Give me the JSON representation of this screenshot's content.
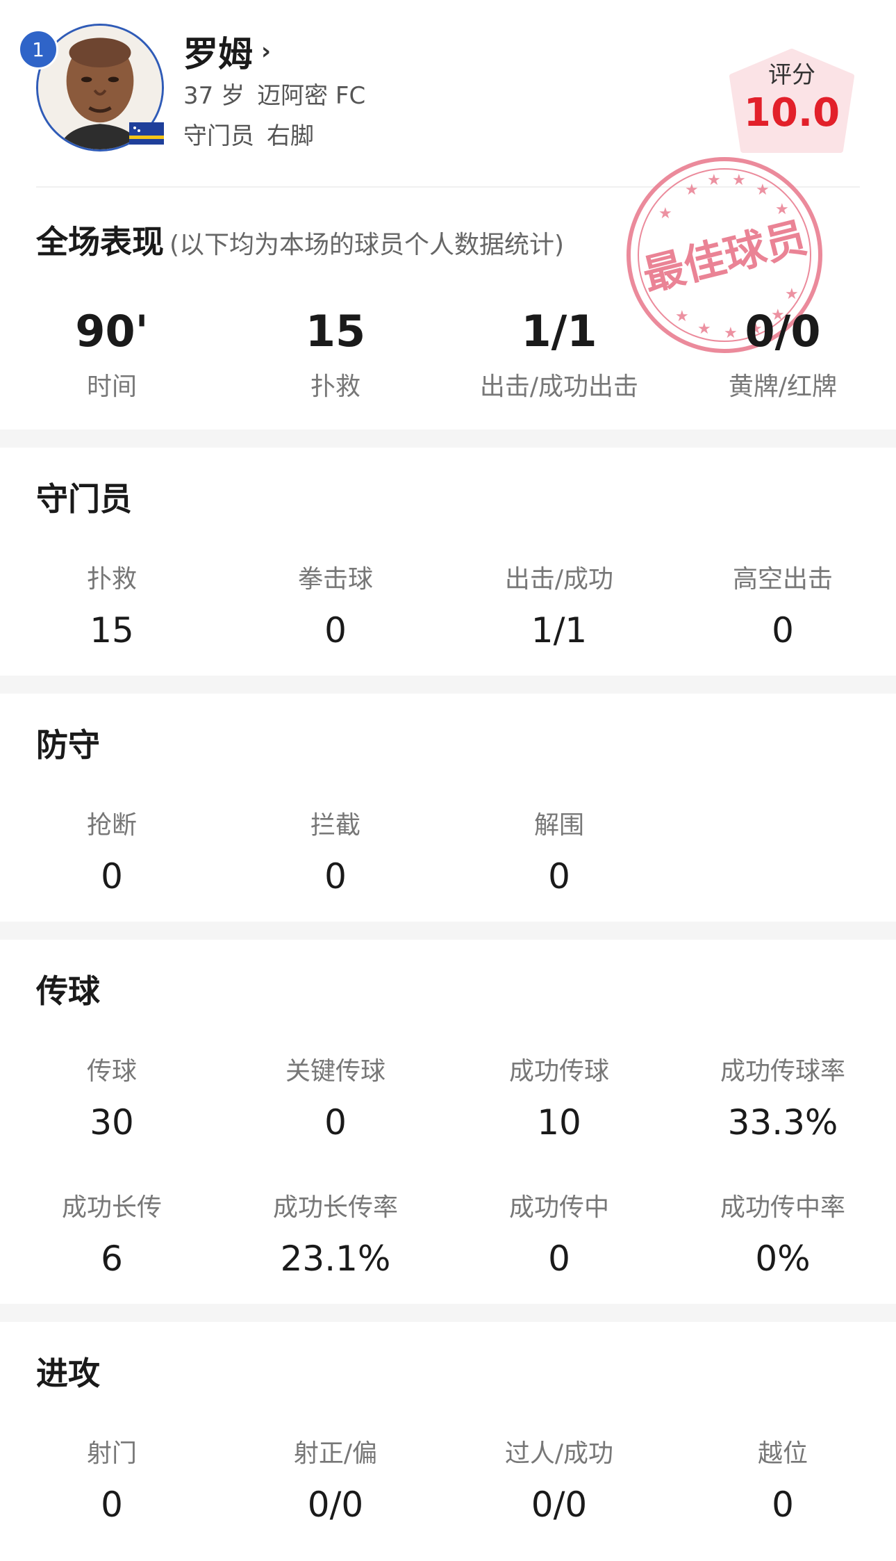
{
  "player": {
    "number": "1",
    "name": "罗姆",
    "age": "37 岁",
    "club": "迈阿密 FC",
    "position": "守门员",
    "foot": "右脚"
  },
  "rating": {
    "label": "评分",
    "value": "10.0",
    "color": "#e2202a",
    "badge_color": "#fbe3e6"
  },
  "stamp": {
    "text": "最佳球员",
    "color": "#e8768a"
  },
  "overall": {
    "title": "全场表现",
    "subtitle": "(以下均为本场的球员个人数据统计)",
    "stats": [
      {
        "value": "90'",
        "label": "时间"
      },
      {
        "value": "15",
        "label": "扑救"
      },
      {
        "value": "1/1",
        "label": "出击/成功出击"
      },
      {
        "value": "0/0",
        "label": "黄牌/红牌"
      }
    ]
  },
  "goalkeeper": {
    "title": "守门员",
    "stats": [
      {
        "label": "扑救",
        "value": "15"
      },
      {
        "label": "拳击球",
        "value": "0"
      },
      {
        "label": "出击/成功",
        "value": "1/1"
      },
      {
        "label": "高空出击",
        "value": "0"
      }
    ]
  },
  "defense": {
    "title": "防守",
    "stats": [
      {
        "label": "抢断",
        "value": "0"
      },
      {
        "label": "拦截",
        "value": "0"
      },
      {
        "label": "解围",
        "value": "0"
      }
    ]
  },
  "passing": {
    "title": "传球",
    "row1": [
      {
        "label": "传球",
        "value": "30"
      },
      {
        "label": "关键传球",
        "value": "0"
      },
      {
        "label": "成功传球",
        "value": "10"
      },
      {
        "label": "成功传球率",
        "value": "33.3%"
      }
    ],
    "row2": [
      {
        "label": "成功长传",
        "value": "6"
      },
      {
        "label": "成功长传率",
        "value": "23.1%"
      },
      {
        "label": "成功传中",
        "value": "0"
      },
      {
        "label": "成功传中率",
        "value": "0%"
      }
    ]
  },
  "attack": {
    "title": "进攻",
    "stats": [
      {
        "label": "射门",
        "value": "0"
      },
      {
        "label": "射正/偏",
        "value": "0/0"
      },
      {
        "label": "过人/成功",
        "value": "0/0"
      },
      {
        "label": "越位",
        "value": "0"
      }
    ]
  }
}
